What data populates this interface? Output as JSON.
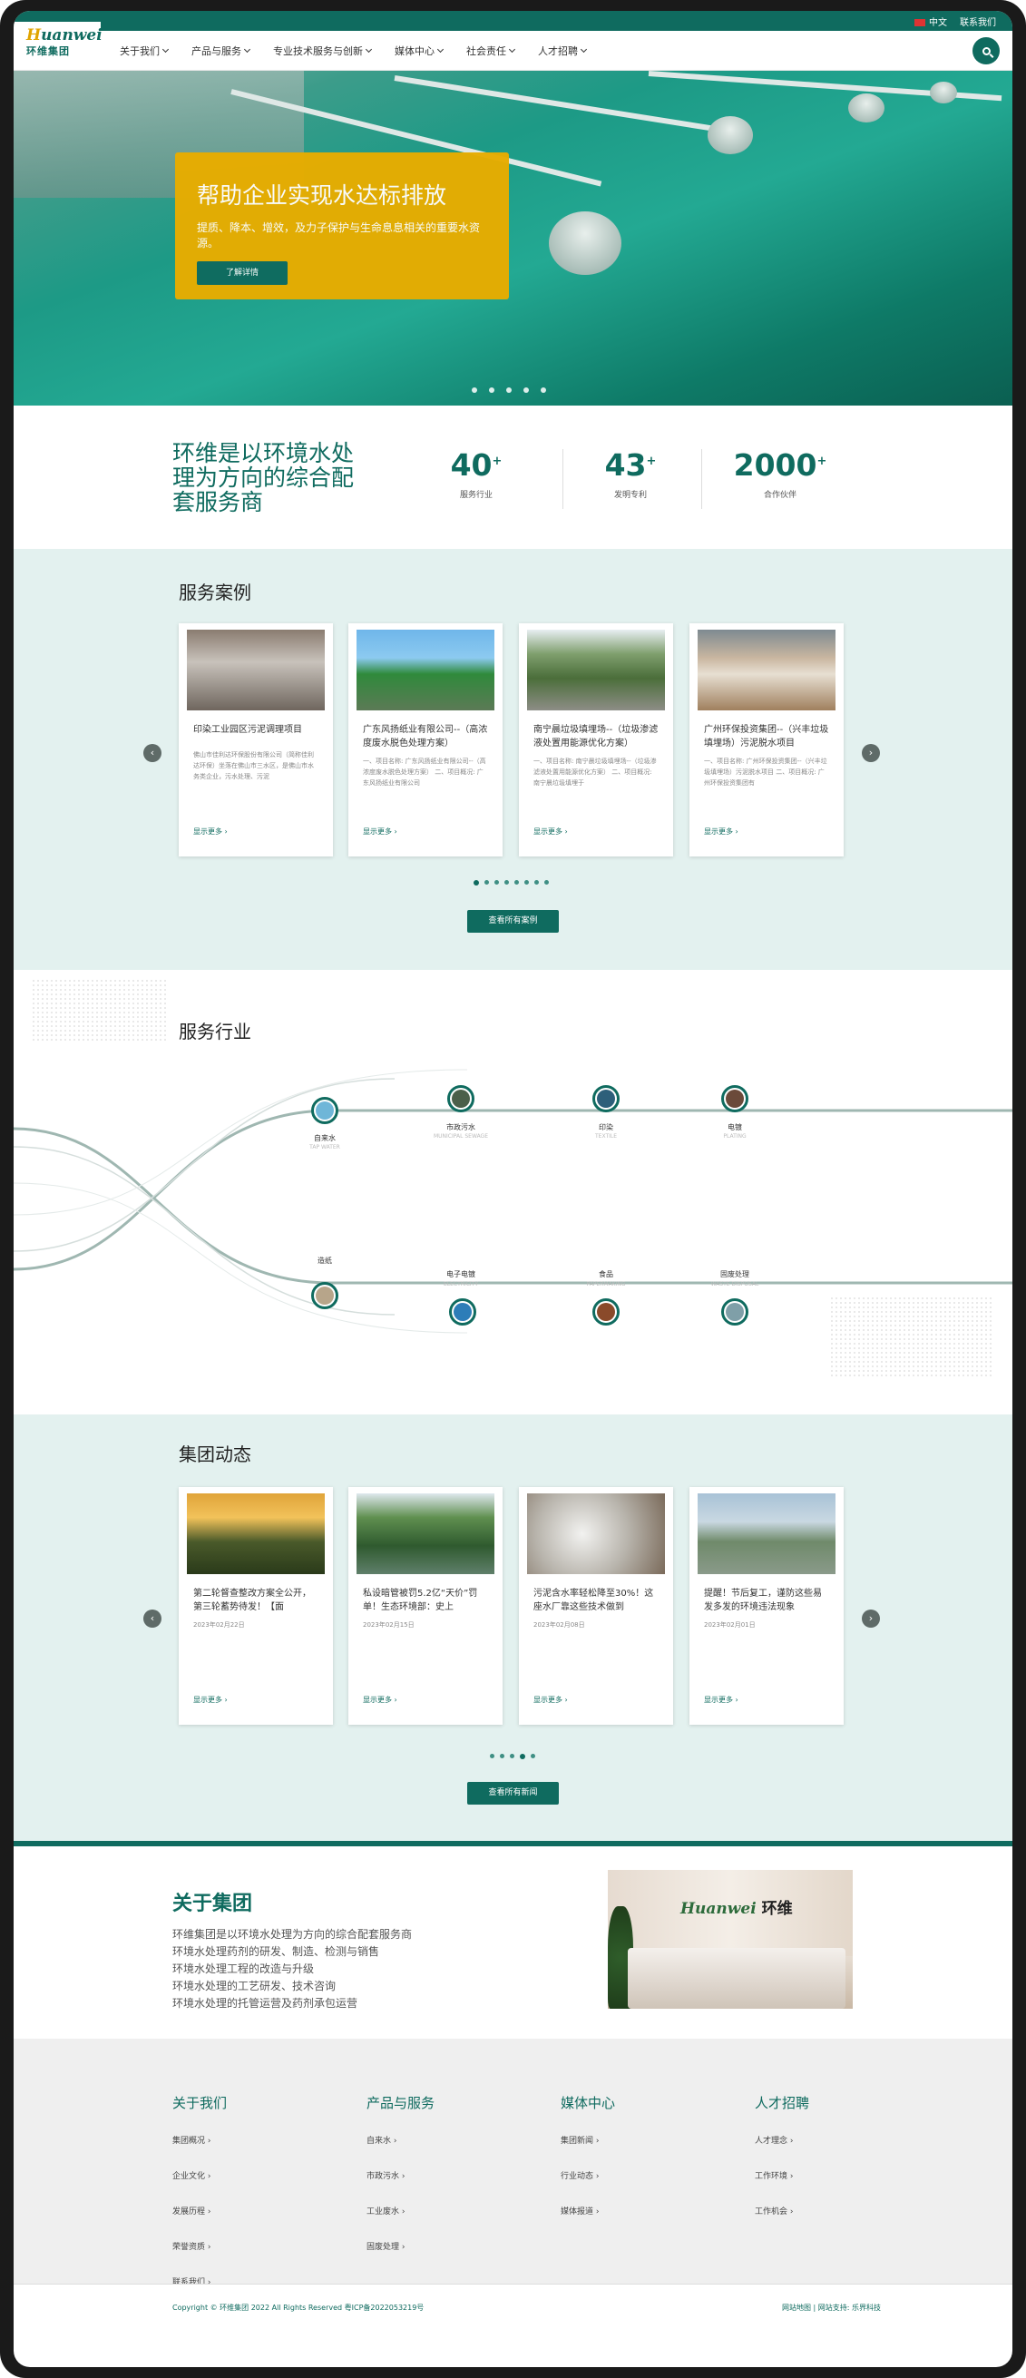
{
  "topbar": {
    "lang": "中文",
    "contact": "联系我们"
  },
  "logo": {
    "en_prefix": "H",
    "en_rest": "uanwei",
    "cn": "环维集团"
  },
  "nav": [
    "关于我们",
    "产品与服务",
    "专业技术服务与创新",
    "媒体中心",
    "社会责任",
    "人才招聘"
  ],
  "hero": {
    "title": "帮助企业实现水达标排放",
    "subtitle": "提质、降本、增效，及力子保护与生命息息相关的重要水资源。",
    "button": "了解详情",
    "slides": 5
  },
  "stats": {
    "heading": "环维是以环境水处理为方向的综合配套服务商",
    "items": [
      {
        "num": "40",
        "plus": "+",
        "label": "服务行业"
      },
      {
        "num": "43",
        "plus": "+",
        "label": "发明专利"
      },
      {
        "num": "2000",
        "plus": "+",
        "label": "合作伙伴"
      }
    ]
  },
  "cases": {
    "title": "服务案例",
    "more_label": "显示更多",
    "button": "查看所有案例",
    "pages": 8,
    "items": [
      {
        "title": "印染工业园区污泥调理项目",
        "desc": "佛山市佳利达环保股份有限公司（简称佳利达环保）坐落在佛山市三水区，是佛山市水务类企业，污水处理、污泥"
      },
      {
        "title": "广东风扬纸业有限公司--（高浓度废水脱色处理方案）",
        "desc": "一、项目名称: 广东风扬纸业有限公司--（高浓度废水脱色处理方案） 二、项目概况: 广东风扬纸业有限公司"
      },
      {
        "title": "南宁晨垃圾填埋场--（垃圾渗滤液处置用能源优化方案）",
        "desc": "一、项目名称: 南宁晨垃圾填埋场--（垃圾渗滤液处置用能源优化方案） 二、项目概况: 南宁晨垃圾填埋于"
      },
      {
        "title": "广州环保投资集团--（兴丰垃圾填埋场）污泥脱水项目",
        "desc": "一、项目名称: 广州环保投资集团--（兴丰垃圾填埋场）污泥脱水项目 二、项目概况: 广州环保投资集团有"
      }
    ]
  },
  "industry": {
    "title": "服务行业",
    "top": [
      {
        "cn": "自来水",
        "en": "TAP WATER"
      },
      {
        "cn": "市政污水",
        "en": "MUNICIPAL SEWAGE"
      },
      {
        "cn": "印染",
        "en": "TEXTILE"
      },
      {
        "cn": "电镀",
        "en": "PLATING"
      }
    ],
    "bottom": [
      {
        "cn": "造纸",
        "en": "PAPERMAKING"
      },
      {
        "cn": "电子电镀",
        "en": "ELECTRICITY"
      },
      {
        "cn": "食品",
        "en": "PAPERMAKING"
      },
      {
        "cn": "固废处理",
        "en": "WASTE DISPOSAL"
      }
    ]
  },
  "news": {
    "title": "集团动态",
    "more_label": "显示更多",
    "button": "查看所有新闻",
    "pages": 5,
    "items": [
      {
        "title": "第二轮督查整改方案全公开，第三轮蓄势待发！【面",
        "date": "2023年02月22日"
      },
      {
        "title": "私设暗管被罚5.2亿“天价”罚单！生态环境部：史上",
        "date": "2023年02月15日"
      },
      {
        "title": "污泥含水率轻松降至30%！这座水厂靠这些技术做到",
        "date": "2023年02月08日"
      },
      {
        "title": "提醒！节后复工，谨防这些易发多发的环境违法现象",
        "date": "2023年02月01日"
      }
    ]
  },
  "about": {
    "title": "关于集团",
    "lines": [
      "环维集团是以环境水处理为方向的综合配套服务商",
      "环境水处理药剂的研发、制造、检测与销售",
      "环境水处理工程的改造与升级",
      "环境水处理的工艺研发、技术咨询",
      "环境水处理的托管运营及药剂承包运营"
    ],
    "photo_logo_en": "Huanwei",
    "photo_logo_cn": "环维"
  },
  "footer": {
    "cols": [
      {
        "title": "关于我们",
        "links": [
          "集团概况",
          "企业文化",
          "发展历程",
          "荣誉资质",
          "联系我们"
        ]
      },
      {
        "title": "产品与服务",
        "links": [
          "自来水",
          "市政污水",
          "工业废水",
          "固废处理"
        ]
      },
      {
        "title": "媒体中心",
        "links": [
          "集团新闻",
          "行业动态",
          "媒体报道"
        ]
      },
      {
        "title": "人才招聘",
        "links": [
          "人才理念",
          "工作环境",
          "工作机会"
        ]
      }
    ],
    "copyright": "Copyright © 环维集团  2022 All Rights Reserved  粤ICP备2022053219号",
    "right": "网站地图 | 网站支持: 乐界科技"
  }
}
